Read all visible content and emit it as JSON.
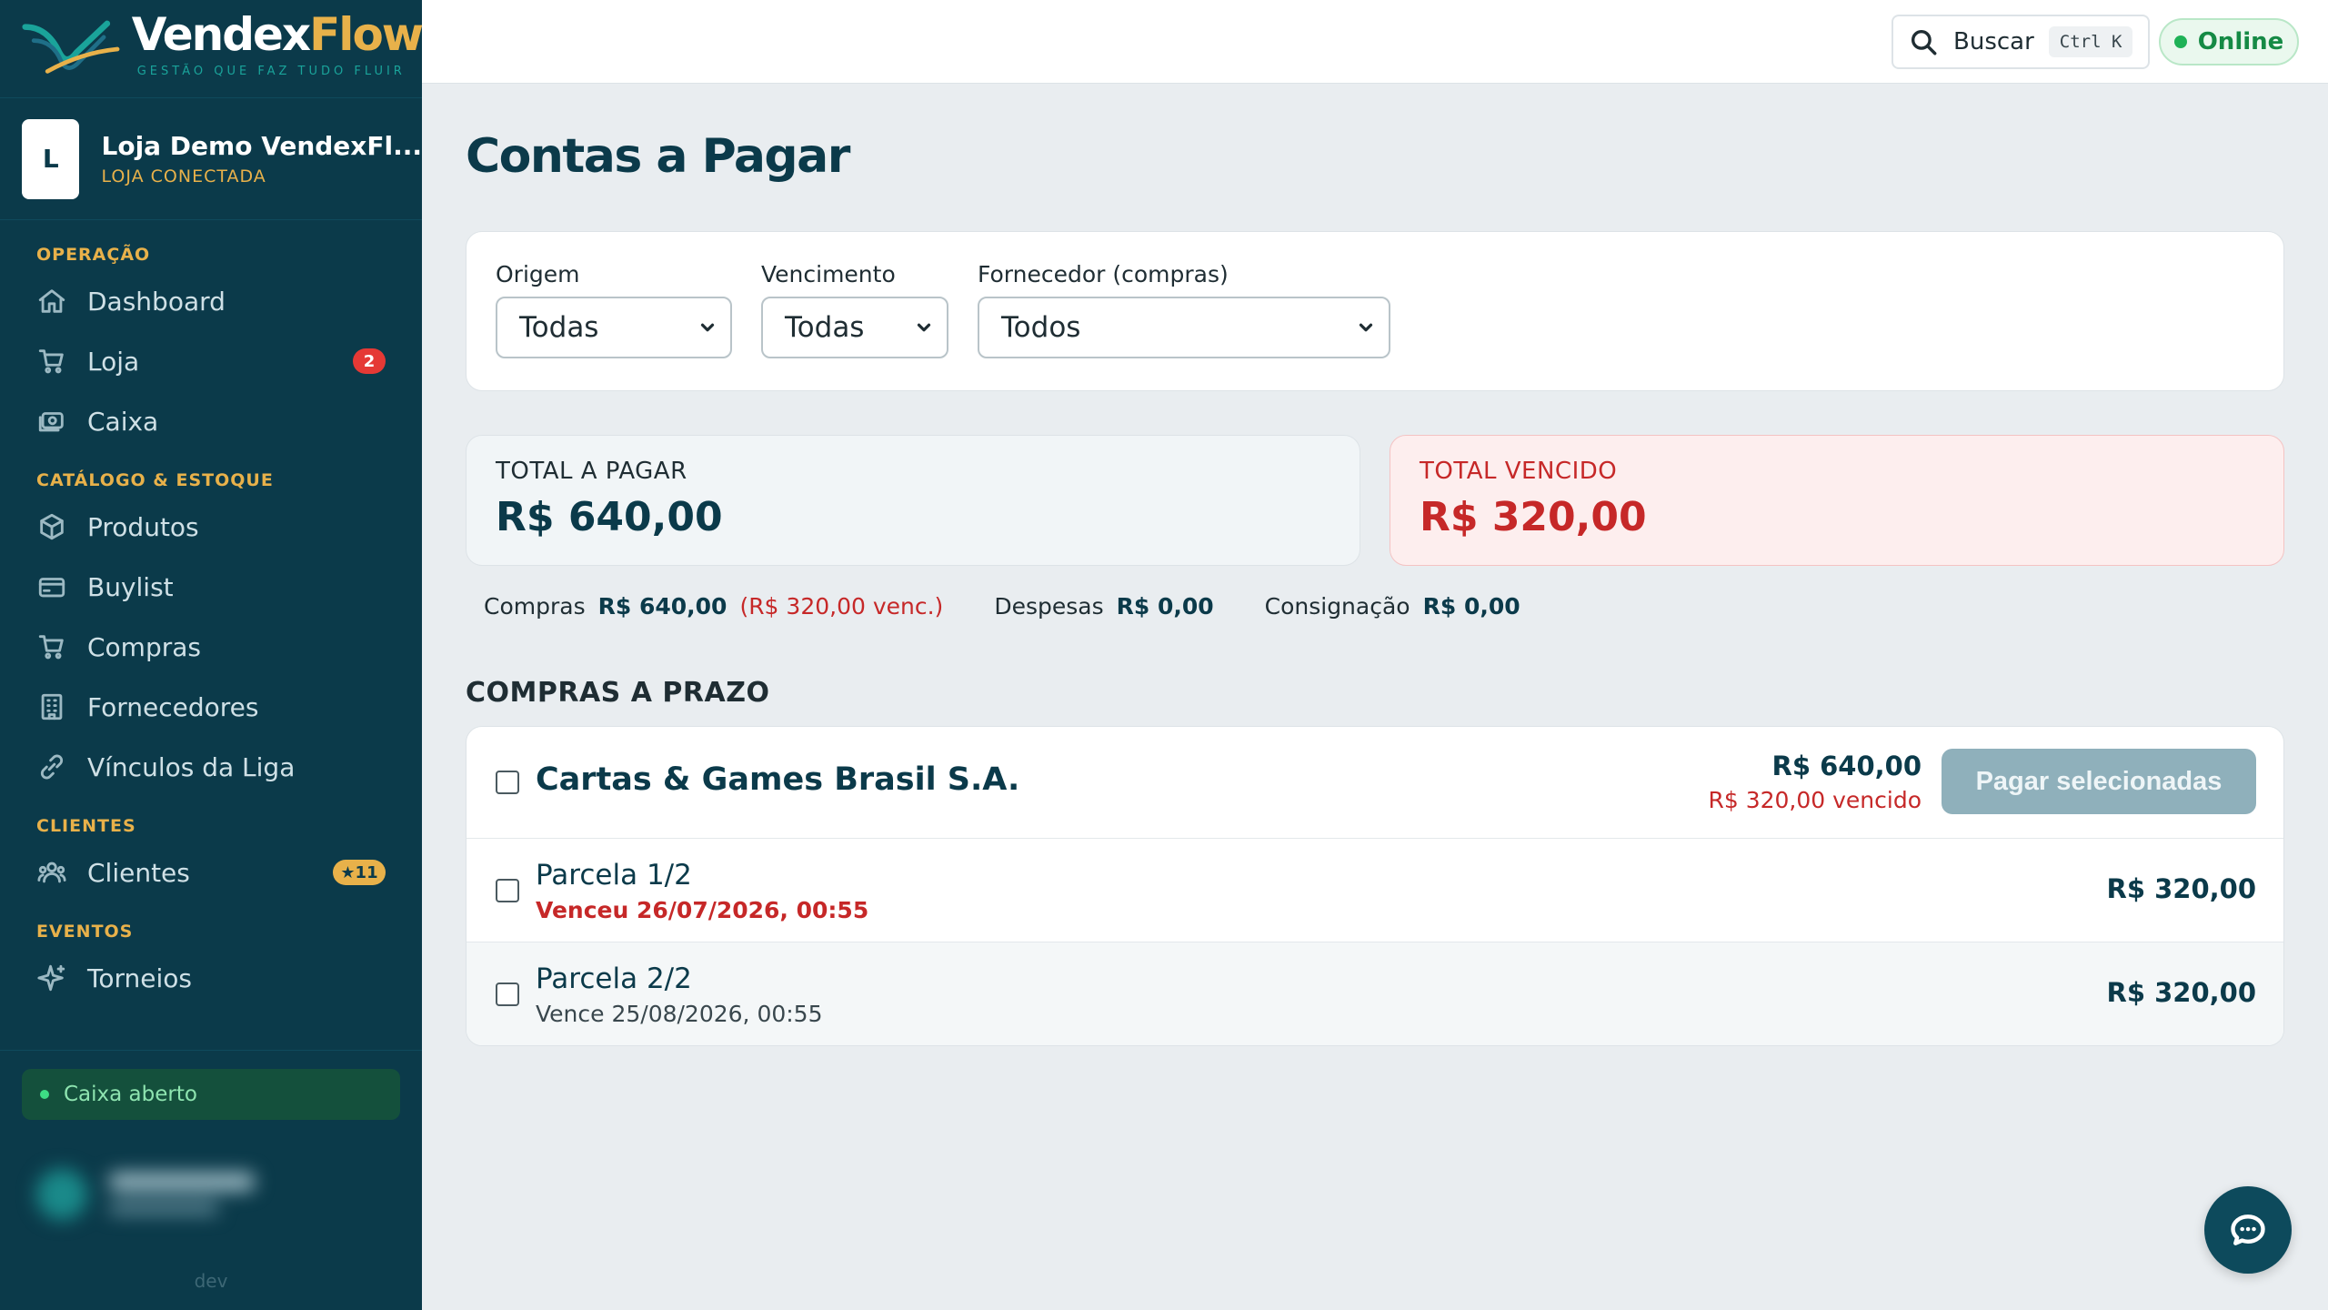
{
  "brand": {
    "name_part1": "Vendex",
    "name_part2": "Flow",
    "tagline": "GESTÃO QUE FAZ TUDO FLUIR"
  },
  "store": {
    "initial": "L",
    "name": "Loja Demo VendexFl...",
    "status": "LOJA CONECTADA"
  },
  "sidebar": {
    "sections": [
      {
        "title": "OPERAÇÃO",
        "items": [
          {
            "label": "Dashboard",
            "icon": "home-icon"
          },
          {
            "label": "Loja",
            "icon": "cart-icon",
            "badge": "2"
          },
          {
            "label": "Caixa",
            "icon": "cash-icon"
          }
        ]
      },
      {
        "title": "CATÁLOGO & ESTOQUE",
        "items": [
          {
            "label": "Produtos",
            "icon": "box-icon"
          },
          {
            "label": "Buylist",
            "icon": "card-icon"
          },
          {
            "label": "Compras",
            "icon": "cart-icon"
          },
          {
            "label": "Fornecedores",
            "icon": "building-icon"
          },
          {
            "label": "Vínculos da Liga",
            "icon": "link-icon"
          }
        ]
      },
      {
        "title": "CLIENTES",
        "items": [
          {
            "label": "Clientes",
            "icon": "users-icon",
            "badge": "★11"
          }
        ]
      },
      {
        "title": "EVENTOS",
        "items": [
          {
            "label": "Torneios",
            "icon": "sparkle-icon"
          }
        ]
      }
    ],
    "cash_status": "Caixa aberto",
    "env": "dev"
  },
  "topbar": {
    "search_label": "Buscar",
    "search_shortcut": "Ctrl K",
    "status": "Online"
  },
  "page": {
    "title": "Contas a Pagar"
  },
  "filters": {
    "origem": {
      "label": "Origem",
      "value": "Todas"
    },
    "vencimento": {
      "label": "Vencimento",
      "value": "Todas"
    },
    "fornecedor": {
      "label": "Fornecedor (compras)",
      "value": "Todos"
    }
  },
  "totals": {
    "a_pagar": {
      "label": "TOTAL A PAGAR",
      "value": "R$ 640,00"
    },
    "vencido": {
      "label": "TOTAL VENCIDO",
      "value": "R$ 320,00"
    }
  },
  "breakdown": {
    "compras": {
      "label": "Compras",
      "value": "R$ 640,00",
      "note": "(R$ 320,00 venc.)"
    },
    "despesas": {
      "label": "Despesas",
      "value": "R$ 0,00"
    },
    "consignacao": {
      "label": "Consignação",
      "value": "R$ 0,00"
    }
  },
  "section": {
    "title": "COMPRAS A PRAZO"
  },
  "supplier_group": {
    "name": "Cartas & Games Brasil S.A.",
    "total": "R$ 640,00",
    "overdue": "R$ 320,00 vencido",
    "pay_button": "Pagar selecionadas",
    "parcels": [
      {
        "name": "Parcela 1/2",
        "due": "Venceu 26/07/2026, 00:55",
        "amount": "R$ 320,00",
        "overdue": true
      },
      {
        "name": "Parcela 2/2",
        "due": "Vence 25/08/2026, 00:55",
        "amount": "R$ 320,00",
        "overdue": false
      }
    ]
  },
  "colors": {
    "sidebar_bg": "#0b3a4a",
    "accent_gold": "#e8b14a",
    "danger": "#c62828",
    "success": "#1fb257"
  }
}
